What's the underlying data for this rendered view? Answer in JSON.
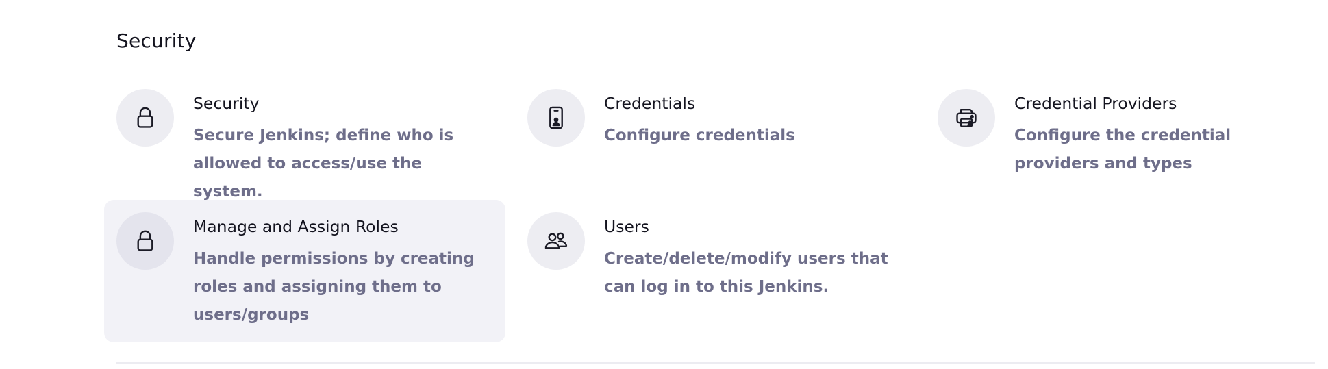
{
  "section": {
    "title": "Security"
  },
  "items": [
    {
      "title": "Security",
      "description": "Secure Jenkins; define who is allowed to access/use the system.",
      "icon": "lock-icon"
    },
    {
      "title": "Credentials",
      "description": "Configure credentials",
      "icon": "phone-id-icon"
    },
    {
      "title": "Credential Providers",
      "description": "Configure the credential providers and types",
      "icon": "printer-icon"
    },
    {
      "title": "Manage and Assign Roles",
      "description": "Handle permissions by creating roles and assigning them to users/groups",
      "icon": "lock-icon"
    },
    {
      "title": "Users",
      "description": "Create/delete/modify users that can log in to this Jenkins.",
      "icon": "users-icon"
    }
  ],
  "colors": {
    "title_text": "#14141f",
    "description_text": "#6e6e8a",
    "icon_circle_bg": "#ededf2",
    "hover_card_bg": "#f2f2f7"
  }
}
